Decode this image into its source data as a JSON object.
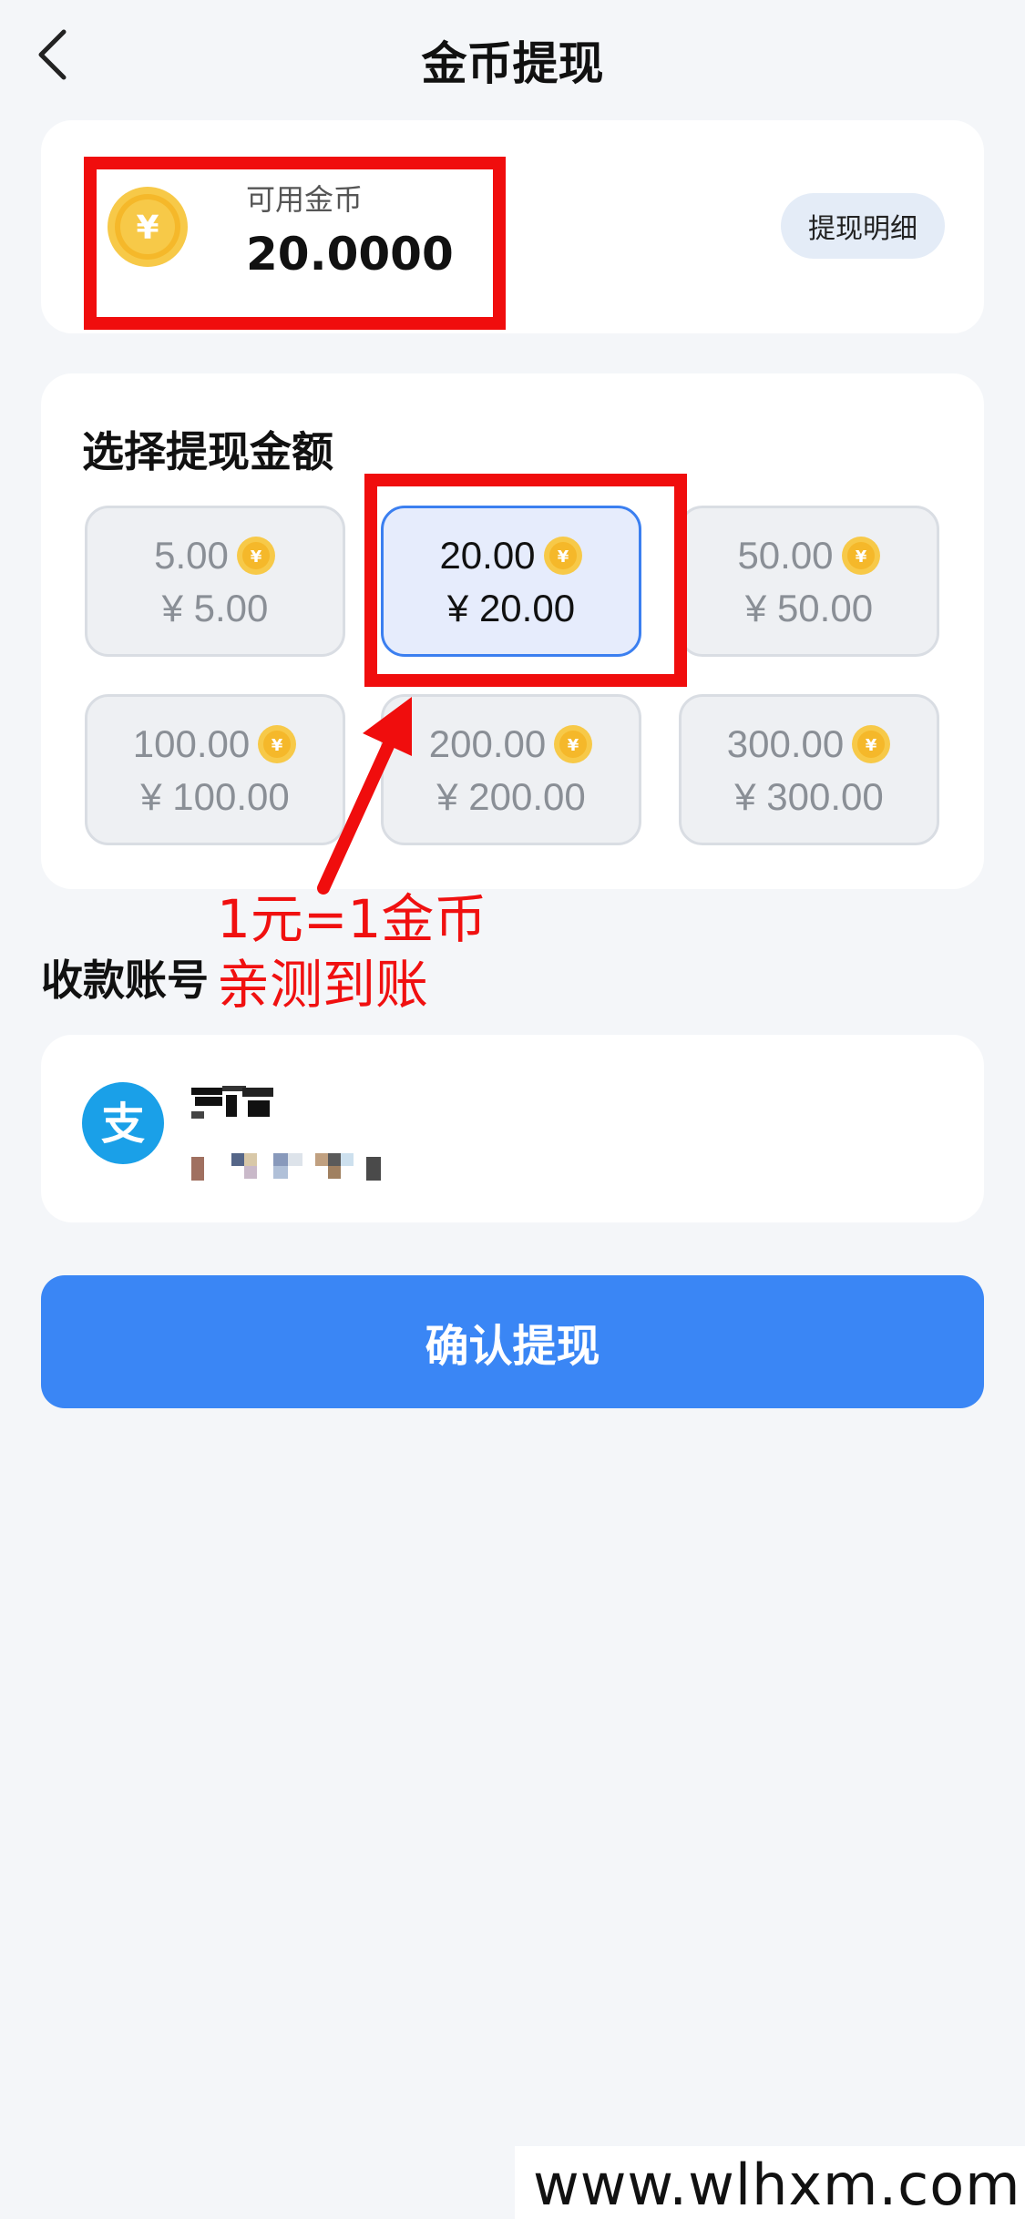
{
  "header": {
    "title": "金币提现"
  },
  "balance": {
    "label": "可用金币",
    "value": "20.0000",
    "history_button": "提现明细"
  },
  "amount_section": {
    "title": "选择提现金额",
    "options": [
      {
        "coins": "5.00",
        "yuan": "¥ 5.00",
        "selected": false
      },
      {
        "coins": "20.00",
        "yuan": "¥ 20.00",
        "selected": true
      },
      {
        "coins": "50.00",
        "yuan": "¥ 50.00",
        "selected": false
      },
      {
        "coins": "100.00",
        "yuan": "¥ 100.00",
        "selected": false
      },
      {
        "coins": "200.00",
        "yuan": "¥ 200.00",
        "selected": false
      },
      {
        "coins": "300.00",
        "yuan": "¥ 300.00",
        "selected": false
      }
    ]
  },
  "account_section": {
    "title": "收款账号",
    "method_icon": "alipay-icon",
    "icon_glyph": "支"
  },
  "confirm_button": "确认提现",
  "annotation": {
    "line1": "1元=1金币",
    "line2": "亲测到账"
  },
  "watermark": "www.wlhxm.com",
  "colors": {
    "accent": "#3a86f5",
    "coin": "#f5c223",
    "annotation": "#f01010",
    "alipay": "#1aa0e8"
  }
}
